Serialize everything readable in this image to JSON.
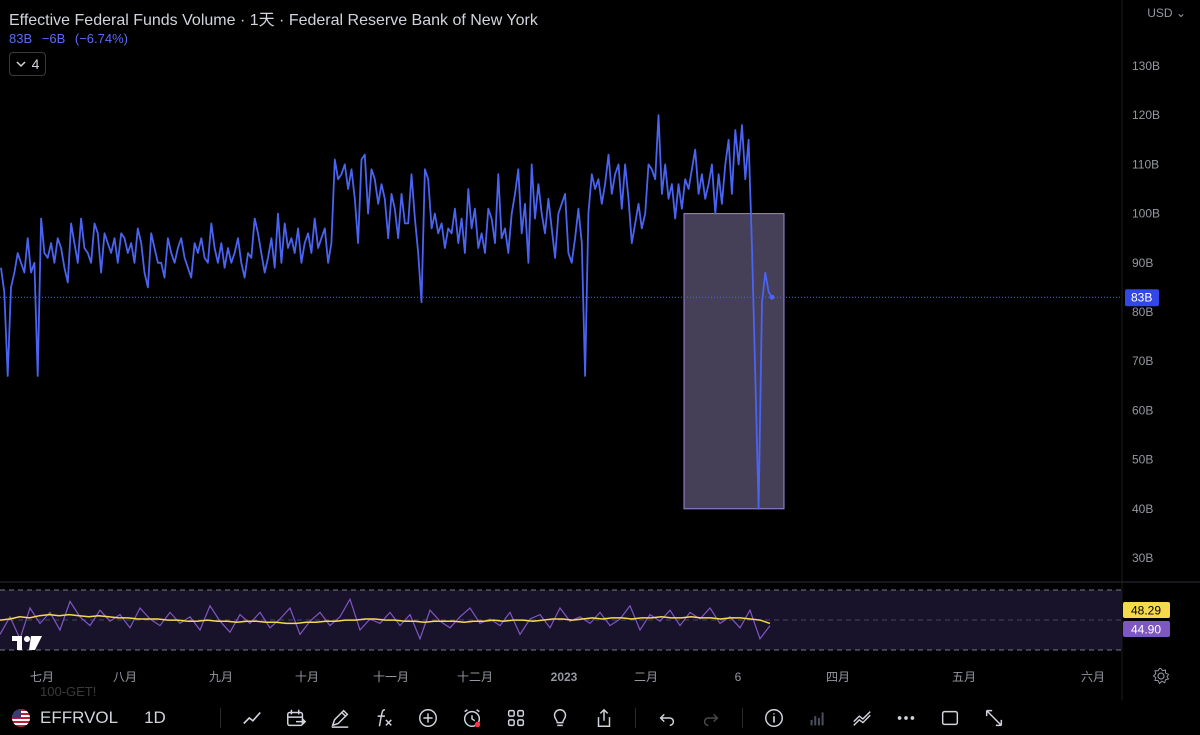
{
  "header": {
    "title": "Effective Federal Funds Volume · 1天 · Federal Reserve Bank of New York",
    "value": "83B",
    "change": "−6B",
    "change_pct": "(−6.74%)",
    "collapse_count": "4"
  },
  "currency": "USD",
  "y_axis": {
    "ticks": [
      "130B",
      "120B",
      "110B",
      "100B",
      "90B",
      "80B",
      "70B",
      "60B",
      "50B",
      "40B",
      "30B"
    ]
  },
  "price_label": "83B",
  "oscillator": {
    "value_a": "48.29",
    "value_b": "44.90",
    "color_a": "#f7d94c",
    "color_b": "#7e57c2"
  },
  "x_axis": {
    "labels": [
      "七月",
      "八月",
      "九月",
      "十月",
      "十一月",
      "十二月",
      "2023",
      "二月",
      "6",
      "四月",
      "五月",
      "六月"
    ]
  },
  "watermark": "100-GET!",
  "colors": {
    "line": "#4a63f0",
    "highlight": "#b9a6e8",
    "label_bg": "#3347e6",
    "bg": "#000000"
  },
  "toolbar": {
    "symbol": "EFFRVOL",
    "interval": "1D",
    "icons": [
      "indicators-line-icon",
      "compare-calendar-icon",
      "draw-icon",
      "function-icon",
      "add-icon",
      "alert-icon",
      "layout-icon",
      "idea-icon",
      "share-icon",
      "undo-icon",
      "redo-icon",
      "info-icon",
      "bar-style-icon",
      "trend-icon",
      "more-icon",
      "square-icon",
      "fullscreen-icon"
    ]
  },
  "chart_data": {
    "type": "line",
    "title": "Effective Federal Funds Volume · 1天 · Federal Reserve Bank of New York",
    "xlabel": "",
    "ylabel": "",
    "ylim": [
      25,
      135
    ],
    "x_labels": [
      "七月",
      "八月",
      "九月",
      "十月",
      "十一月",
      "十二月",
      "2023",
      "二月",
      "6",
      "四月",
      "五月",
      "六月"
    ],
    "series": [
      {
        "values": [
          89,
          84,
          67,
          85,
          88,
          92,
          90,
          88,
          95,
          88,
          90,
          67,
          99,
          92,
          91,
          94,
          90,
          95,
          93,
          89,
          86,
          98,
          94,
          90,
          99,
          93,
          92,
          90,
          98,
          96,
          88,
          96,
          94,
          92,
          95,
          90,
          96,
          95,
          92,
          94,
          90,
          97,
          94,
          88,
          85,
          96,
          93,
          90,
          90,
          87,
          95,
          92,
          90,
          93,
          95,
          91,
          89,
          87,
          94,
          92,
          95,
          91,
          90,
          98,
          93,
          90,
          94,
          89,
          93,
          90,
          92,
          95,
          90,
          87,
          92,
          91,
          99,
          96,
          92,
          88,
          91,
          95,
          89,
          100,
          90,
          98,
          93,
          95,
          92,
          97,
          90,
          94,
          96,
          92,
          99,
          93,
          95,
          97,
          90,
          94,
          111,
          107,
          108,
          110,
          105,
          109,
          103,
          94,
          111,
          112,
          100,
          109,
          107,
          102,
          106,
          103,
          95,
          104,
          101,
          95,
          104,
          98,
          98,
          108,
          99,
          92,
          82,
          109,
          107,
          97,
          100,
          96,
          98,
          93,
          97,
          96,
          101,
          94,
          99,
          92,
          105,
          97,
          101,
          93,
          96,
          92,
          101,
          99,
          94,
          108,
          95,
          97,
          92,
          100,
          104,
          109,
          96,
          102,
          90,
          110,
          99,
          106,
          100,
          96,
          103,
          97,
          91,
          100,
          102,
          104,
          92,
          90,
          95,
          101,
          94,
          67,
          100,
          108,
          105,
          107,
          102,
          106,
          112,
          104,
          108,
          110,
          101,
          110,
          103,
          94,
          98,
          102,
          97,
          100,
          110,
          109,
          107,
          120,
          104,
          110,
          103,
          106,
          99,
          106,
          101,
          107,
          105,
          109,
          113,
          104,
          108,
          103,
          106,
          110,
          100,
          108,
          102,
          110,
          115,
          104,
          117,
          110,
          118,
          107,
          115,
          93,
          67,
          40,
          82,
          88,
          84,
          83
        ]
      }
    ],
    "price_level": 83,
    "highlight_box": {
      "y_range": [
        40,
        100
      ]
    },
    "oscillator": {
      "series_a": [
        46.5,
        47,
        48,
        47.5,
        48.5,
        49,
        48.5,
        49,
        48.5,
        48,
        48.5,
        48,
        47.5,
        47.5,
        47,
        47,
        47,
        46.5,
        46.5,
        46,
        46,
        46.5,
        46,
        46,
        45.5,
        46,
        46,
        45.5,
        45.5,
        45,
        45,
        45.5,
        45.5,
        46,
        46,
        46.5,
        46.5,
        47,
        47,
        46.5,
        46.5,
        46,
        46,
        45.5,
        46,
        46,
        46,
        45.5,
        46,
        46,
        46.5,
        46,
        46.5,
        46.5,
        46,
        46.5,
        47,
        47,
        46.5,
        47,
        47.5,
        47,
        47.5,
        47.5,
        47,
        47.5,
        47.5,
        48,
        47.5,
        47.5,
        48,
        47.5,
        47.5,
        47,
        47.5,
        47.5,
        47,
        46.5,
        45
      ],
      "series_b": [
        40,
        48,
        38,
        52,
        45,
        50,
        42,
        55,
        48,
        44,
        51,
        46,
        49,
        43,
        52,
        47,
        44,
        50,
        45,
        48,
        42,
        53,
        46,
        41,
        49,
        45,
        50,
        43,
        47,
        52,
        40,
        46,
        50,
        44,
        48,
        56,
        42,
        47,
        45,
        50,
        44,
        49,
        38,
        51,
        46,
        43,
        48,
        52,
        45,
        47,
        44,
        50,
        40,
        47,
        49,
        43,
        52,
        46,
        48,
        45,
        50,
        44,
        47,
        53,
        42,
        49,
        46,
        51,
        44,
        50,
        47,
        52,
        45,
        48,
        43,
        51,
        38,
        44
      ]
    }
  }
}
